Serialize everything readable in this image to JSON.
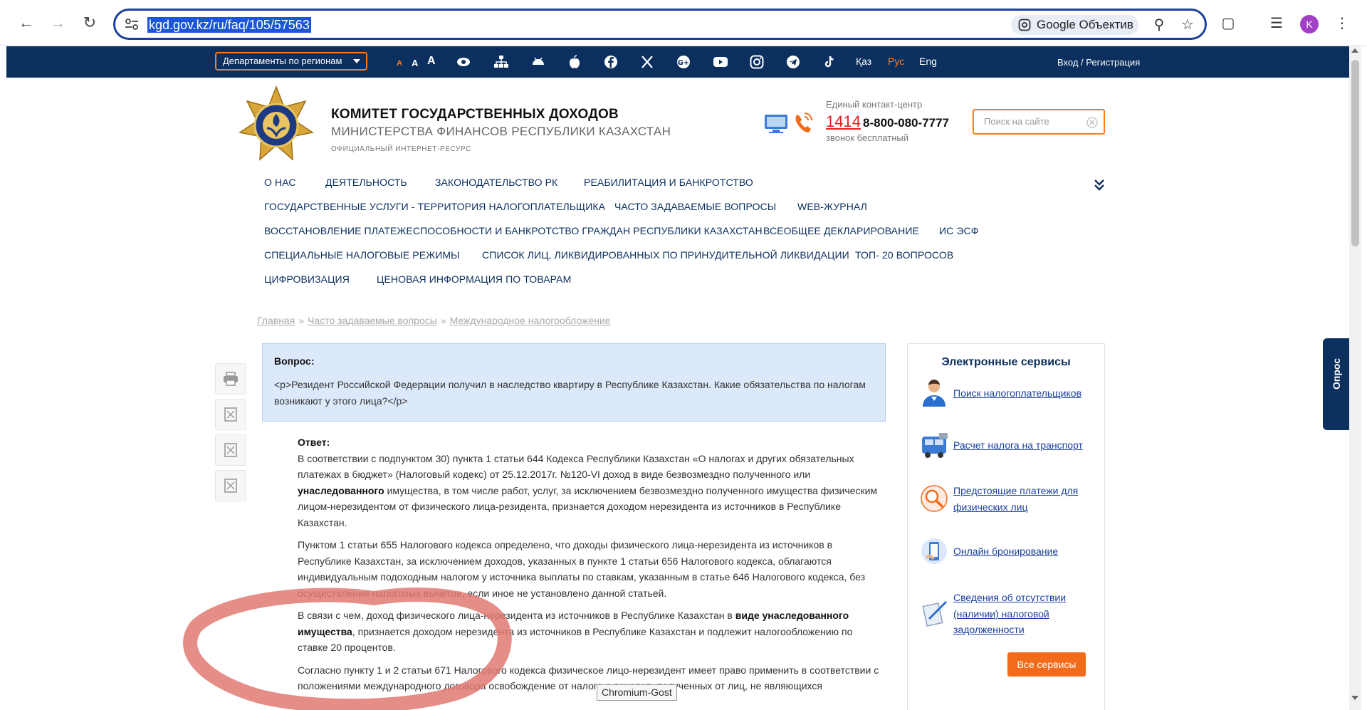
{
  "browser": {
    "url": "kgd.gov.kz/ru/faq/105/57563",
    "lens_label": "Google Объектив",
    "avatar_initial": "K",
    "tooltip": "Chromium-Gost"
  },
  "topbar": {
    "departments_label": "Департаменты по регионам",
    "font_sizes": [
      "A",
      "A",
      "A"
    ],
    "languages": [
      {
        "label": "Қаз",
        "active": false
      },
      {
        "label": "Рус",
        "active": true
      },
      {
        "label": "Eng",
        "active": false
      }
    ],
    "login_label": "Вход / Регистрация"
  },
  "header": {
    "title": "КОМИТЕТ ГОСУДАРСТВЕННЫХ ДОХОДОВ",
    "subtitle": "МИНИСТЕРСТВА ФИНАНСОВ РЕСПУБЛИКИ КАЗАХСТАН",
    "resource": "ОФИЦИАЛЬНЫЙ ИНТЕРНЕТ-РЕСУРС",
    "contact_label": "Единый контакт-центр",
    "short_number": "1414",
    "phone": "8-800-080-7777",
    "free_call": "звонок бесплатный",
    "search_placeholder": "Поиск на сайте"
  },
  "menu": {
    "items": [
      "О НАС",
      "ДЕЯТЕЛЬНОСТЬ",
      "ЗАКОНОДАТЕЛЬСТВО РК",
      "РЕАБИЛИТАЦИЯ И БАНКРОТСТВО",
      "ГОСУДАРСТВЕННЫЕ УСЛУГИ - ТЕРРИТОРИЯ НАЛОГОПЛАТЕЛЬЩИКА",
      "ЧАСТО ЗАДАВАЕМЫЕ ВОПРОСЫ",
      "WEB-ЖУРНАЛ",
      "ВОССТАНОВЛЕНИЕ ПЛАТЕЖЕСПОСОБНОСТИ И БАНКРОТСТВО ГРАЖДАН РЕСПУБЛИКИ КАЗАХСТАН",
      "ВСЕОБЩЕЕ ДЕКЛАРИРОВАНИЕ",
      "ИС ЭСФ",
      "СПЕЦИАЛЬНЫЕ НАЛОГОВЫЕ РЕЖИМЫ",
      "СПИСОК ЛИЦ, ЛИКВИДИРОВАННЫХ ПО ПРИНУДИТЕЛЬНОЙ ЛИКВИДАЦИИ",
      "ТОП- 20 ВОПРОСОВ",
      "ЦИФРОВИЗАЦИЯ",
      "ЦЕНОВАЯ ИНФОРМАЦИЯ ПО ТОВАРАМ"
    ]
  },
  "breadcrumb": [
    "Главная",
    "Часто задаваемые вопросы",
    "Международное налогообложение"
  ],
  "question": {
    "label": "Вопрос:",
    "text": "<p>Резидент Российской Федерации получил в наследство квартиру в Республике Казахстан. Какие обязательства по налогам возникают у этого лица?</p>"
  },
  "answer": {
    "label": "Ответ:",
    "p1_a": "В соответствии с подпунктом 30) пункта 1 статьи 644 Кодекса Республики Казахстан «О налогах и других обязательных платежах в бюджет» (Налоговый кодекс) от 25.12.2017г. №120-VI доход в виде безвозмездно полученного или ",
    "p1_b": "унаследованного",
    "p1_c": " имущества, в том числе работ, услуг, за исключением безвозмездно полученного имущества физическим лицом-нерезидентом от физического лица-резидента, признается доходом нерезидента из источников в Республике Казахстан.",
    "p2": "Пунктом 1 статьи 655 Налогового кодекса определено, что доходы физического лица-нерезидента из источников в Республике Казахстан, за исключением доходов, указанных в пункте 1 статьи 656 Налогового кодекса, облагаются индивидуальным подоходным налогом у источника выплаты по ставкам, указанным в статье 646 Налогового кодекса, без осуществления налоговых вычетов, если иное не установлено данной статьей.",
    "p3_a": "В связи с чем, доход физического лица-нерезидента из источников в Республике Казахстан в ",
    "p3_b": "виде унаследованного имущества",
    "p3_c": ", признается доходом нерезидента из источников в Республике Казахстан и подлежит налогообложению по ставке 20 процентов.",
    "p4": "Согласно пункту 1 и 2 статьи 671 Налогового кодекса физическое лицо-нерезидент имеет право применить в соответствии с положениями международного договора освобождение от налога с доходов, полученных от лиц, не являющихся"
  },
  "services": {
    "title": "Электронные сервисы",
    "items": [
      {
        "label": "Поиск налогоплательщиков",
        "icon": "person-icon"
      },
      {
        "label": "Расчет налога на транспорт",
        "icon": "bus-icon"
      },
      {
        "label": "Предстоящие платежи для физических лиц",
        "icon": "magnifier-icon"
      },
      {
        "label": "Онлайн бронирование",
        "icon": "phone-booking-icon"
      },
      {
        "label": "Сведения об отсутствии (наличии) налоговой задолженности",
        "icon": "document-pen-icon"
      }
    ],
    "all_label": "Все сервисы"
  },
  "survey_label": "Опрос",
  "colors": {
    "navy": "#0b2f5e",
    "orange": "#f26b1a",
    "question_bg": "#dce9fb",
    "annotation": "#e07a72"
  }
}
